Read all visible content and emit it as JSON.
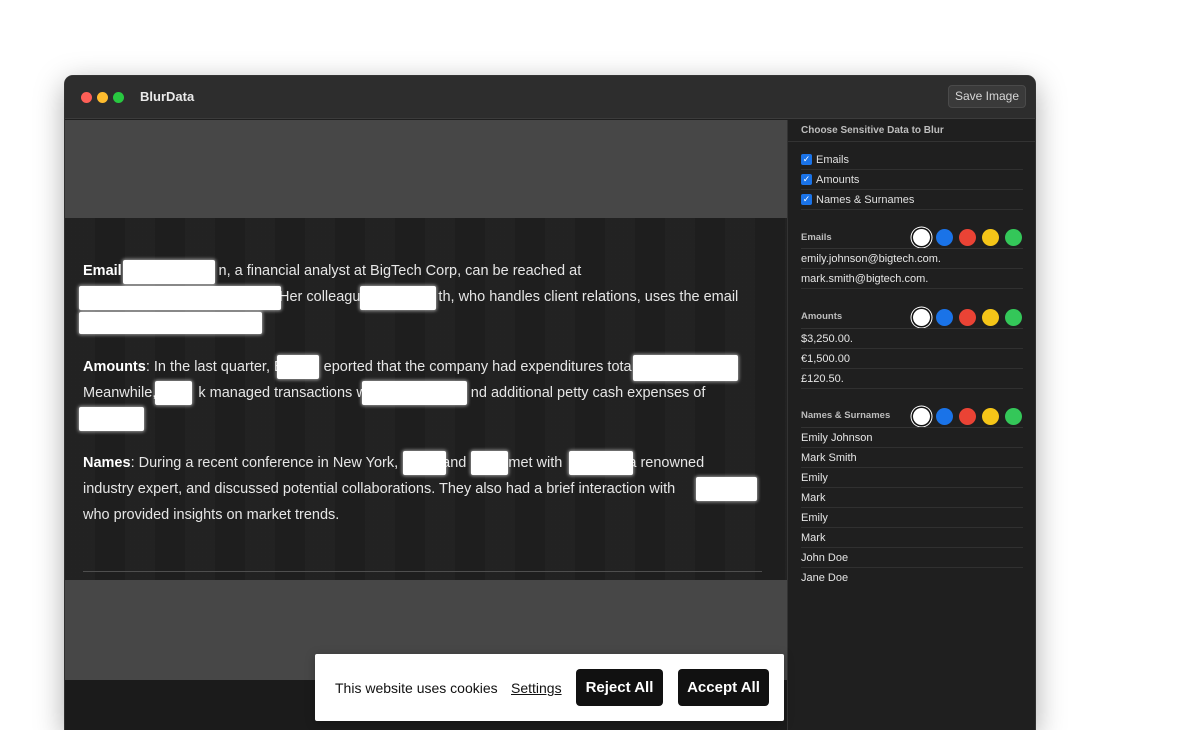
{
  "app": {
    "title": "BlurData",
    "save_label": "Save Image"
  },
  "document": {
    "p1": {
      "label": "Email:",
      "segments": [
        "n, a financial analyst at BigTech Corp, can be reached at",
        "Her colleagu",
        "th, who handles client relations, uses the email"
      ]
    },
    "p2": {
      "label": "Amounts",
      "segments": [
        ": In the last quarter, E",
        "eported that the company had expenditures tota",
        "Meanwhile,",
        "k managed transactions w",
        "nd additional petty cash expenses of"
      ]
    },
    "p3": {
      "label": "Names",
      "segments": [
        ": During a recent conference in New York,",
        "and",
        "met with",
        "a renowned",
        "industry expert, and discussed potential collaborations. They also had a brief interaction with",
        "who provided insights on market trends."
      ]
    }
  },
  "sidebar": {
    "header": "Choose Sensitive Data to Blur",
    "checks": [
      {
        "label": "Emails",
        "checked": true
      },
      {
        "label": "Amounts",
        "checked": true
      },
      {
        "label": "Names & Surnames",
        "checked": true
      }
    ],
    "swatch_colors": [
      "#ffffff",
      "#1a73e8",
      "#ea4335",
      "#f5c518",
      "#34c759"
    ],
    "sections": {
      "emails": {
        "title": "Emails",
        "items": [
          "emily.johnson@bigtech.com.",
          "mark.smith@bigtech.com."
        ]
      },
      "amounts": {
        "title": "Amounts",
        "items": [
          "$3,250.00.",
          "€1,500.00",
          "£120.50."
        ]
      },
      "names": {
        "title": "Names & Surnames",
        "items": [
          "Emily Johnson",
          "Mark Smith",
          "Emily",
          "Mark",
          "Emily",
          "Mark",
          "John Doe",
          "Jane Doe"
        ]
      }
    }
  },
  "cookie": {
    "text": "This website uses cookies",
    "settings": "Settings",
    "reject": "Reject All",
    "accept": "Accept All"
  }
}
